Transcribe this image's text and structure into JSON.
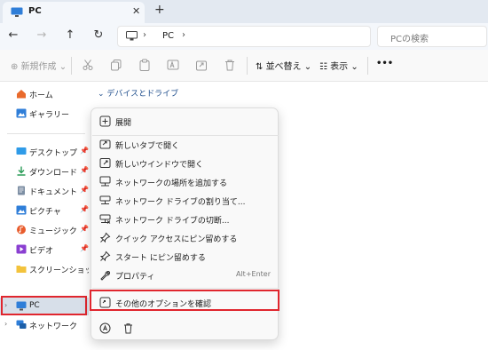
{
  "window": {
    "tab_title": "PC",
    "tab_close": "✕",
    "new_tab": "+"
  },
  "navigation": {
    "back": "←",
    "forward": "→",
    "up": "↑",
    "refresh": "↻",
    "address_location": "PC",
    "search_placeholder": "PCの検索"
  },
  "command_bar": {
    "new_label": "新規作成",
    "sort_label": "並べ替え",
    "view_label": "表示",
    "more_label": "•••"
  },
  "sidebar": {
    "top_items": [
      {
        "label": "ホーム",
        "icon": "home-icon"
      },
      {
        "label": "ギャラリー",
        "icon": "gallery-icon"
      }
    ],
    "pinned_items": [
      {
        "label": "デスクトップ",
        "icon": "desktop-icon"
      },
      {
        "label": "ダウンロード",
        "icon": "download-icon"
      },
      {
        "label": "ドキュメント",
        "icon": "documents-icon"
      },
      {
        "label": "ピクチャ",
        "icon": "pictures-icon"
      },
      {
        "label": "ミュージック",
        "icon": "music-icon"
      },
      {
        "label": "ビデオ",
        "icon": "videos-icon"
      },
      {
        "label": "スクリーンショット",
        "icon": "folder-icon"
      }
    ],
    "pc_label": "PC",
    "network_label": "ネットワーク"
  },
  "content": {
    "group_header": "デバイスとドライブ"
  },
  "context_menu": {
    "items": [
      {
        "label": "展開",
        "icon": "expand-icon"
      },
      {
        "label": "新しいタブで開く",
        "icon": "new-tab-icon"
      },
      {
        "label": "新しいウインドウで開く",
        "icon": "new-window-icon"
      },
      {
        "label": "ネットワークの場所を追加する",
        "icon": "network-location-icon"
      },
      {
        "label": "ネットワーク ドライブの割り当て...",
        "icon": "map-drive-icon"
      },
      {
        "label": "ネットワーク ドライブの切断...",
        "icon": "disconnect-drive-icon"
      },
      {
        "label": "クイック アクセスにピン留めする",
        "icon": "pin-icon"
      },
      {
        "label": "スタート にピン留めする",
        "icon": "pin-start-icon"
      },
      {
        "label": "プロパティ",
        "icon": "properties-icon",
        "shortcut": "Alt+Enter"
      },
      {
        "label": "その他のオプションを確認",
        "icon": "more-options-icon"
      }
    ]
  },
  "colors": {
    "highlight_box": "#e0262e",
    "selected_bg": "#d7dfe9",
    "accent": "#1f6fd1"
  }
}
